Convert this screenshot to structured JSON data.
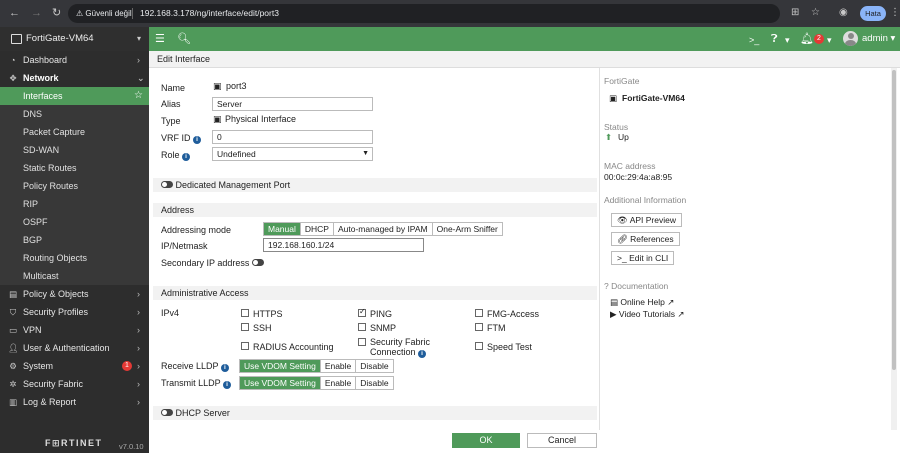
{
  "browser": {
    "security_label": "Güvenli değil",
    "url": "192.168.3.178/ng/interface/edit/port3",
    "profile_label": "Hata"
  },
  "topbar": {
    "device_name": "FortiGate-VM64",
    "notification_count": "2",
    "admin_label": "admin"
  },
  "sidebar": {
    "items": [
      {
        "label": "Dashboard",
        "icon": "dashboard-icon"
      },
      {
        "label": "Network",
        "icon": "network-icon"
      },
      {
        "label": "Policy & Objects",
        "icon": "policy-icon"
      },
      {
        "label": "Security Profiles",
        "icon": "shield-icon"
      },
      {
        "label": "VPN",
        "icon": "vpn-icon"
      },
      {
        "label": "User & Authentication",
        "icon": "user-icon"
      },
      {
        "label": "System",
        "icon": "gear-icon",
        "badge": "1"
      },
      {
        "label": "Security Fabric",
        "icon": "fabric-icon"
      },
      {
        "label": "Log & Report",
        "icon": "chart-icon"
      }
    ],
    "network_sub": [
      "Interfaces",
      "DNS",
      "Packet Capture",
      "SD-WAN",
      "Static Routes",
      "Policy Routes",
      "RIP",
      "OSPF",
      "BGP",
      "Routing Objects",
      "Multicast"
    ],
    "footer_logo": "F⊞RTINET",
    "version": "v7.0.10"
  },
  "page": {
    "title": "Edit Interface"
  },
  "form": {
    "name_label": "Name",
    "name_value": "port3",
    "alias_label": "Alias",
    "alias_value": "Server",
    "type_label": "Type",
    "type_value": "Physical Interface",
    "vrf_label": "VRF ID",
    "vrf_value": "0",
    "role_label": "Role",
    "role_value": "Undefined",
    "dedicated_mgmt_label": "Dedicated Management Port",
    "address_section": "Address",
    "addressing_mode_label": "Addressing mode",
    "addressing_modes": [
      "Manual",
      "DHCP",
      "Auto-managed by IPAM",
      "One-Arm Sniffer"
    ],
    "addressing_mode_selected": "Manual",
    "ip_label": "IP/Netmask",
    "ip_value": "192.168.160.1/24",
    "secondary_ip_label": "Secondary IP address",
    "admin_access_section": "Administrative Access",
    "ipv4_label": "IPv4",
    "access_options": [
      {
        "label": "HTTPS",
        "checked": false
      },
      {
        "label": "PING",
        "checked": true
      },
      {
        "label": "FMG-Access",
        "checked": false
      },
      {
        "label": "SSH",
        "checked": false
      },
      {
        "label": "SNMP",
        "checked": false
      },
      {
        "label": "FTM",
        "checked": false
      },
      {
        "label": "RADIUS Accounting",
        "checked": false
      },
      {
        "label": "Security Fabric",
        "label2": "Connection",
        "checked": false
      },
      {
        "label": "Speed Test",
        "checked": false
      }
    ],
    "receive_lldp_label": "Receive LLDP",
    "transmit_lldp_label": "Transmit LLDP",
    "lldp_options": [
      "Use VDOM Setting",
      "Enable",
      "Disable"
    ],
    "dhcp_server_label": "DHCP Server",
    "ok_label": "OK",
    "cancel_label": "Cancel"
  },
  "right_panel": {
    "device_header": "FortiGate",
    "device_value": "FortiGate-VM64",
    "status_header": "Status",
    "status_value": "Up",
    "mac_header": "MAC address",
    "mac_value": "00:0c:29:4a:a8:95",
    "additional_header": "Additional Information",
    "buttons": [
      "API Preview",
      "References",
      "Edit in CLI"
    ],
    "doc_header": "Documentation",
    "links": [
      "Online Help",
      "Video Tutorials"
    ]
  },
  "colors": {
    "accent": "#4f9a5a",
    "sidebar_bg": "#2d2d2d",
    "link": "#1f5d9b",
    "badge": "#e53935"
  }
}
